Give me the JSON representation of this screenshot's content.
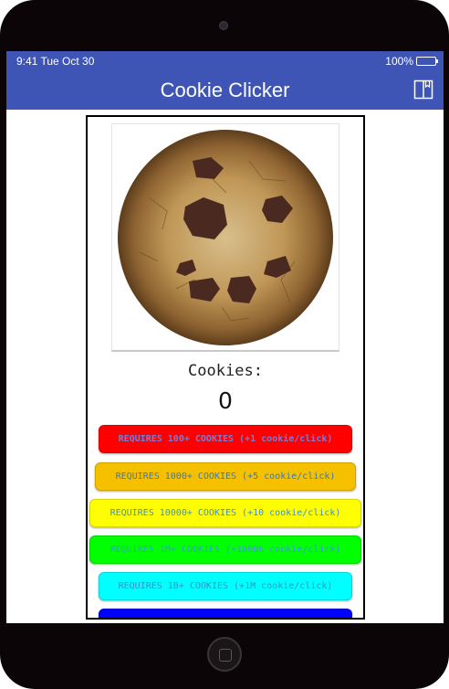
{
  "status_bar": {
    "time": "9:41 Tue Oct 30",
    "battery": "100%"
  },
  "header": {
    "title": "Cookie Clicker",
    "book_icon": "book-icon"
  },
  "cookie": {
    "icon": "cookie-image"
  },
  "counter": {
    "label": "Cookies:",
    "value": "0"
  },
  "upgrades": [
    {
      "label": "REQUIRES 100+ COOKIES (+1 cookie/click)",
      "color": "#ff0000"
    },
    {
      "label": "REQUIRES 1000+ COOKIES (+5 cookie/click)",
      "color": "#f5c000"
    },
    {
      "label": "REQUIRES 10000+ COOKIES (+10 cookie/click)",
      "color": "#ffff00"
    },
    {
      "label": "REQUIRES 1M+ COOKIES (+10000 cookie/click)",
      "color": "#00ff00"
    },
    {
      "label": "REQUIRES 1B+ COOKIES (+1M cookie/click)",
      "color": "#00ffff"
    },
    {
      "label": "",
      "color": "#0000ff"
    }
  ],
  "colors": {
    "header_bg": "#3f55b5",
    "device_frame": "#0b0507"
  }
}
